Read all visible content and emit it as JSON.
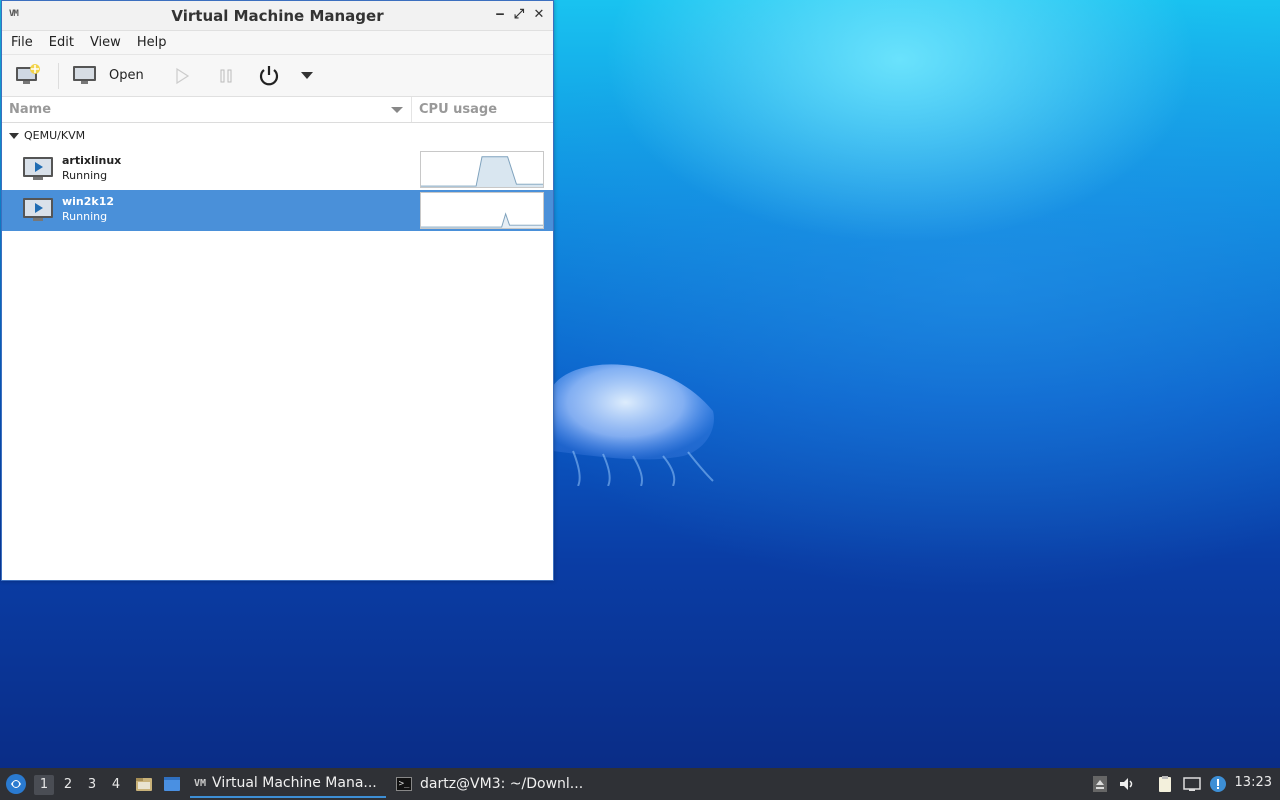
{
  "window": {
    "title": "Virtual Machine Manager"
  },
  "menubar": {
    "items": [
      "File",
      "Edit",
      "View",
      "Help"
    ]
  },
  "toolbar": {
    "open_label": "Open"
  },
  "columns": {
    "name": "Name",
    "cpu": "CPU usage"
  },
  "group": {
    "label": "QEMU/KVM"
  },
  "vms": [
    {
      "name": "artixlinux",
      "status": "Running",
      "selected": false
    },
    {
      "name": "win2k12",
      "status": "Running",
      "selected": true
    }
  ],
  "taskbar": {
    "workspaces": [
      "1",
      "2",
      "3",
      "4"
    ],
    "active_workspace": "1",
    "tasks": [
      {
        "label": "Virtual Machine Mana...",
        "icon": "virt-manager-icon",
        "active": true
      },
      {
        "label": "dartz@VM3: ~/Downl...",
        "icon": "terminal-icon",
        "active": false
      }
    ],
    "clock": "13:23"
  },
  "colors": {
    "selection": "#4a90d9",
    "taskbar": "#2f3136",
    "accent": "#3d8fd6"
  }
}
